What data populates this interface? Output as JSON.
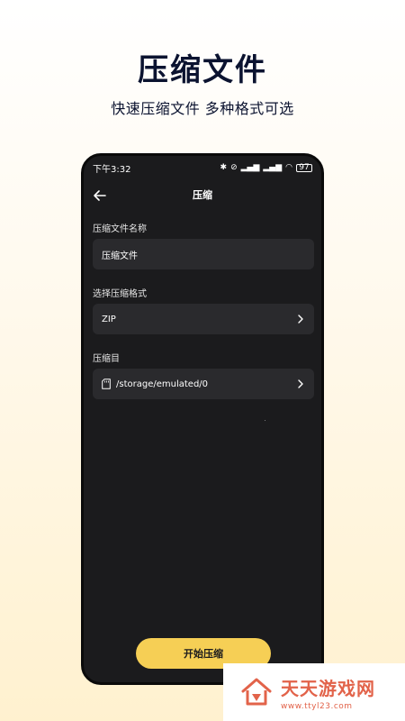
{
  "promo": {
    "title": "压缩文件",
    "subtitle": "快速压缩文件  多种格式可选"
  },
  "statusbar": {
    "time": "下午3:32",
    "icons": [
      "bluetooth-icon",
      "mute-icon",
      "signal-icon",
      "signal-icon",
      "wifi-icon"
    ],
    "battery": "97"
  },
  "screen": {
    "title": "压缩",
    "name_label": "压缩文件名称",
    "name_value": "压缩文件",
    "format_label": "选择压缩格式",
    "format_value": "ZIP",
    "dir_label": "压缩目",
    "dir_value": "/storage/emulated/0",
    "start_button": "开始压缩"
  },
  "watermark": {
    "title": "天天游戏网",
    "url": "www.ttyl23.com"
  },
  "colors": {
    "accent": "#f6cf55",
    "phone_bg": "#1b1b1d",
    "field_bg": "#2a2a2d",
    "watermark": "#e2634a"
  }
}
